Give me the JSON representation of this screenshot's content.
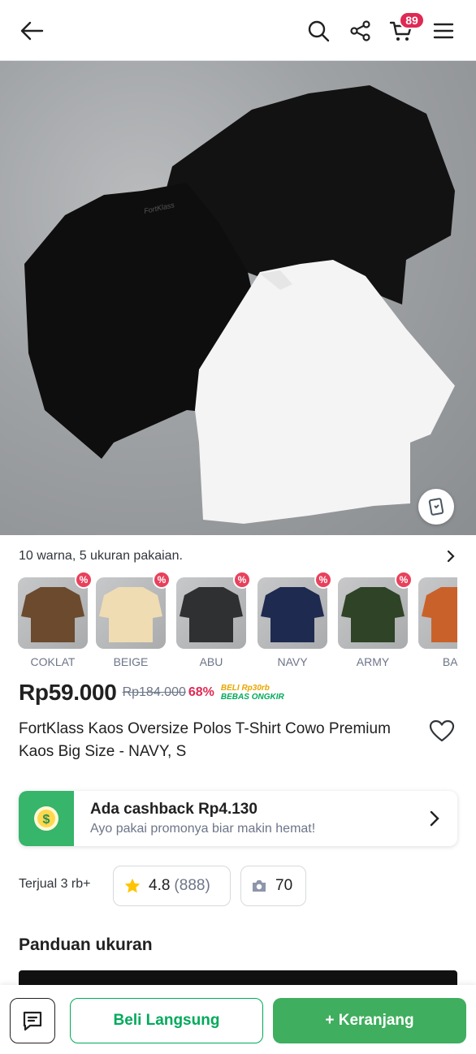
{
  "header": {
    "back_icon": "arrow-left-icon",
    "search_icon": "search-icon",
    "share_icon": "share-icon",
    "cart_icon": "cart-icon",
    "cart_count": "89",
    "menu_icon": "hamburger-menu-icon"
  },
  "variants": {
    "summary": "10 warna, 5 ukuran pakaian.",
    "items": [
      {
        "label": "COKLAT",
        "color": "#6b4a2e",
        "discount": "%"
      },
      {
        "label": "BEIGE",
        "color": "#efdcb3",
        "discount": "%"
      },
      {
        "label": "ABU",
        "color": "#2f3032",
        "discount": "%"
      },
      {
        "label": "NAVY",
        "color": "#1e2a4f",
        "discount": "%"
      },
      {
        "label": "ARMY",
        "color": "#2f4327",
        "discount": "%"
      },
      {
        "label": "BAT",
        "color": "#c9622a",
        "discount": ""
      }
    ]
  },
  "price": {
    "current": "Rp59.000",
    "original": "Rp184.000",
    "discount": "68%",
    "ongkir_line1": "BELI Rp30rb",
    "ongkir_line2": "BEBAS ONGKIR"
  },
  "product": {
    "title": "FortKlass Kaos Oversize Polos T-Shirt Cowo Premium Kaos Big Size - NAVY, S"
  },
  "cashback": {
    "title": "Ada cashback Rp4.130",
    "subtitle": "Ayo pakai promonya biar makin hemat!"
  },
  "stats": {
    "sold": "Terjual 3 rb+",
    "rating": "4.8",
    "reviews": "(888)",
    "photos": "70"
  },
  "section": {
    "size_guide": "Panduan ukuran"
  },
  "actions": {
    "buy_now": "Beli Langsung",
    "add_to_cart": "+ Keranjang"
  },
  "colors": {
    "brand_green": "#00aa5b",
    "cart_button": "#3fae5e",
    "badge_red": "#e02954",
    "star": "#ffc400"
  }
}
